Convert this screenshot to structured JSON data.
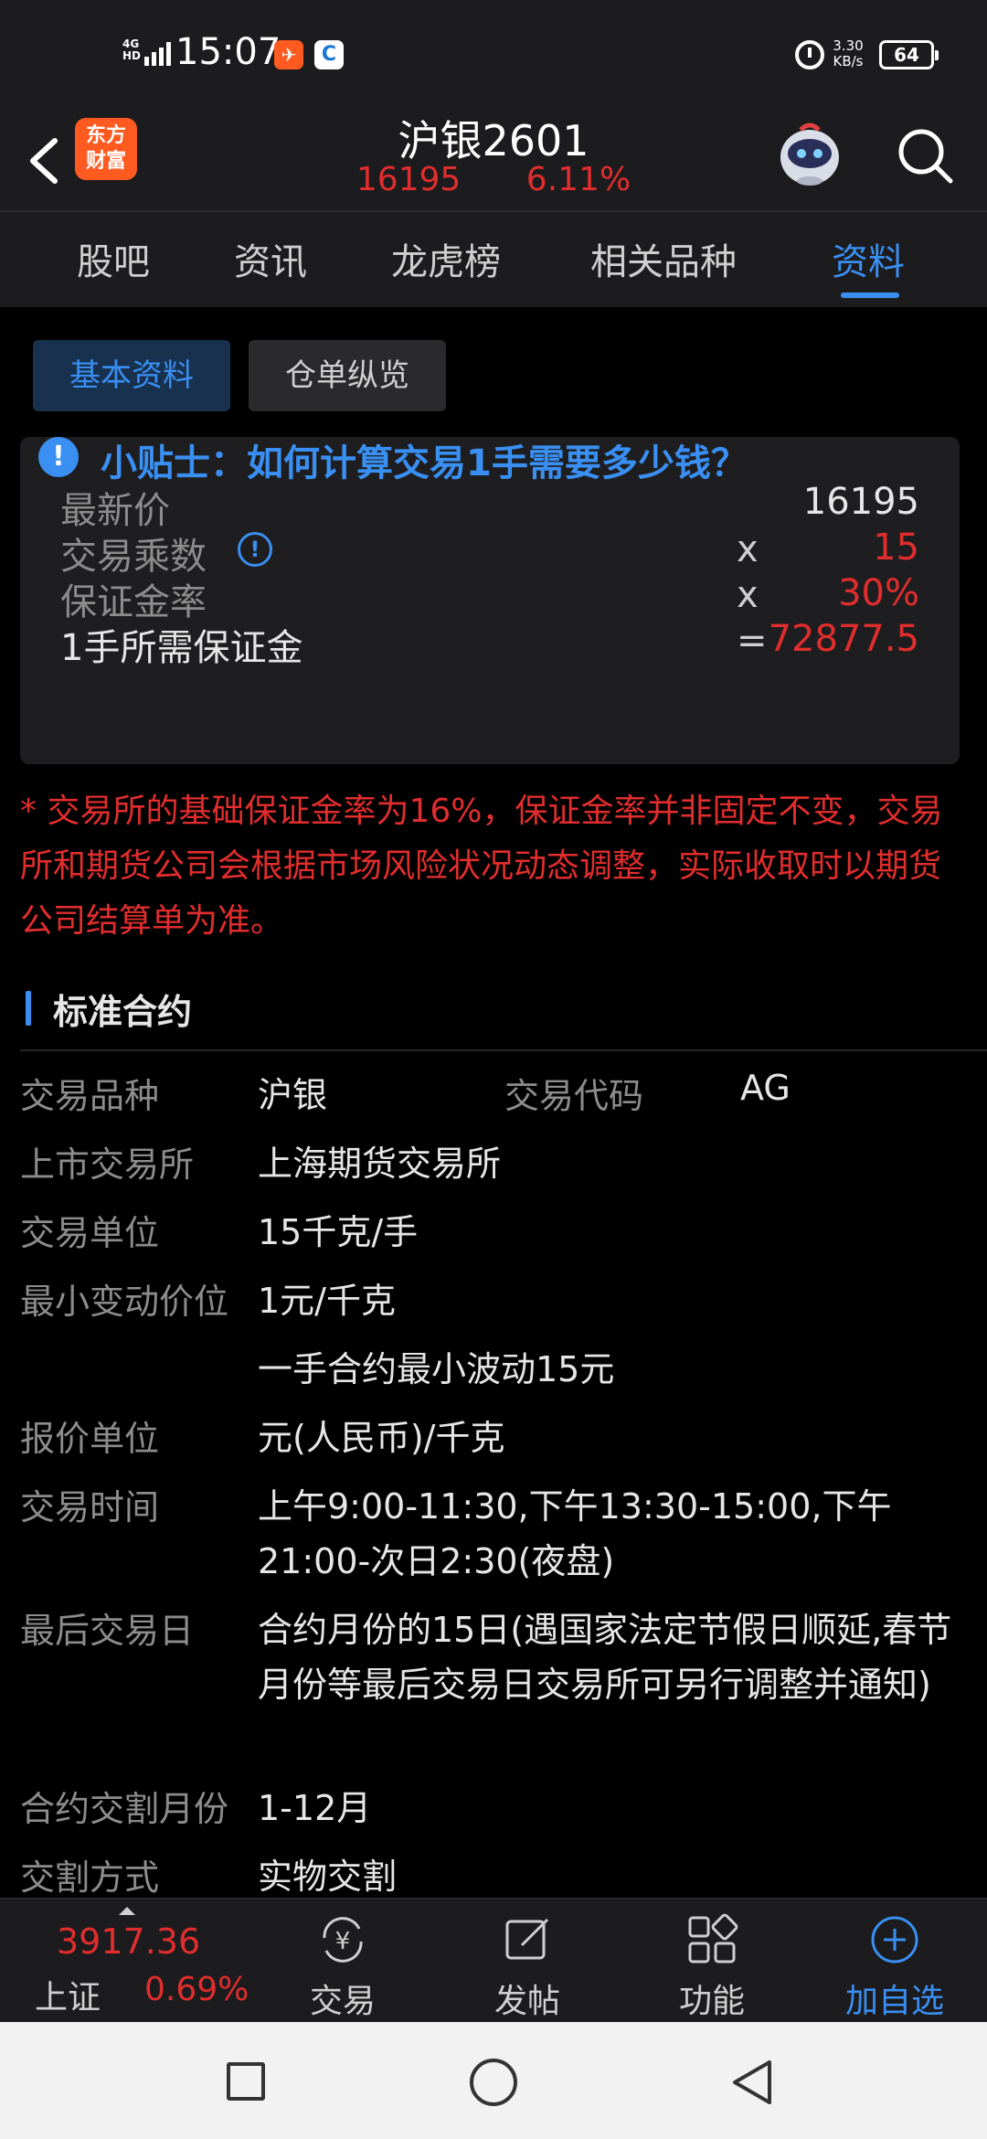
{
  "status_bar": {
    "network": "4G HD",
    "time": "15:07",
    "speed": "3.30",
    "speed_unit": "KB/s",
    "battery": "64"
  },
  "header": {
    "logo_line1": "东方",
    "logo_line2": "财富",
    "title": "沪银2601",
    "price": "16195",
    "change_pct": "6.11%"
  },
  "tabs": [
    "股吧",
    "资讯",
    "龙虎榜",
    "相关品种",
    "资料"
  ],
  "active_tab_index": 4,
  "subtabs": {
    "basic": "基本资料",
    "warehouse": "仓单纵览"
  },
  "tip": {
    "icon": "!",
    "title": "小贴士：如何计算交易1手需要多少钱？",
    "rows": [
      {
        "label": "最新价",
        "op": "",
        "value": "16195"
      },
      {
        "label": "交易乘数",
        "op": "x",
        "value": "15"
      },
      {
        "label": "保证金率",
        "op": "x",
        "value": "30%"
      },
      {
        "label": "1手所需保证金",
        "op": "=",
        "value": "72877.5"
      }
    ]
  },
  "note": "* 交易所的基础保证金率为16%，保证金率并非固定不变，交易所和期货公司会根据市场风险状况动态调整，实际收取时以期货公司结算单为准。",
  "section": {
    "title": "标准合约"
  },
  "contract": {
    "variety_label": "交易品种",
    "variety": "沪银",
    "code_label": "交易代码",
    "code": "AG",
    "exchange_label": "上市交易所",
    "exchange": "上海期货交易所",
    "unit_label": "交易单位",
    "unit": "15千克/手",
    "min_tick_label": "最小变动价位",
    "min_tick": "1元/千克",
    "min_tick_note": "一手合约最小波动15元",
    "quote_unit_label": "报价单位",
    "quote_unit": "元(人民币)/千克",
    "hours_label": "交易时间",
    "hours": "上午9:00-11:30,下午13:30-15:00,下午21:00-次日2:30(夜盘)",
    "last_day_label": "最后交易日",
    "last_day": "合约月份的15日(遇国家法定节假日顺延,春节月份等最后交易日交易所可另行调整并通知)",
    "months_label": "合约交割月份",
    "months": "1-12月",
    "delivery_label": "交割方式",
    "delivery": "实物交割"
  },
  "bottom_bar": {
    "index_value": "3917.36",
    "index_name": "上证",
    "index_pct": "0.69%",
    "trade": "交易",
    "post": "发帖",
    "features": "功能",
    "add_watch": "加自选"
  },
  "colors": {
    "accent": "#3a8ff2",
    "up_red": "#e12d2d",
    "brand_orange": "#ff5a1f"
  }
}
